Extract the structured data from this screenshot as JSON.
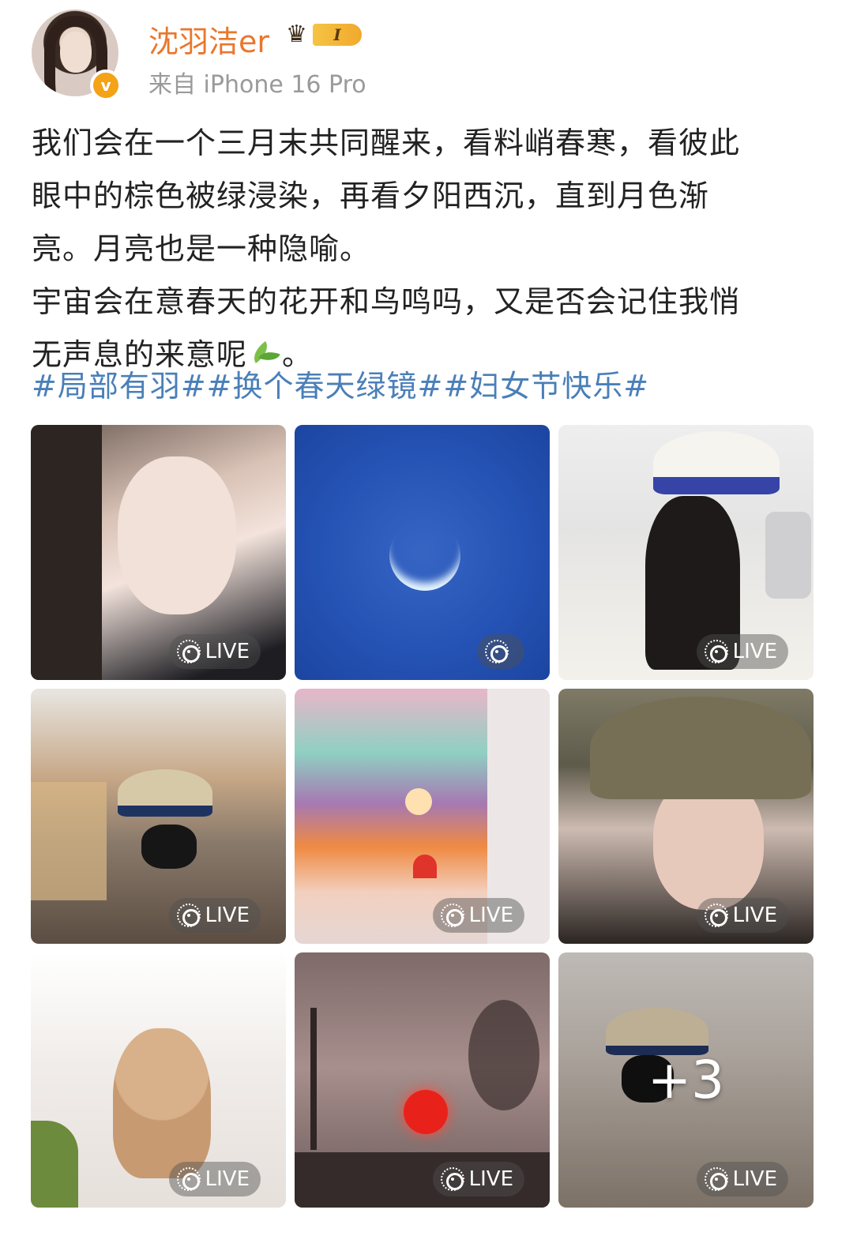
{
  "user": {
    "name": "沈羽洁er",
    "vip_level": "I",
    "source": "来自 iPhone 16 Pro"
  },
  "post": {
    "lines": [
      "我们会在一个三月末共同醒来，看料峭春寒，看彼此",
      "眼中的棕色被绿浸染，再看夕阳西沉，直到月色渐",
      "亮。月亮也是一种隐喻。",
      "宇宙会在意春天的花开和鸟鸣吗，又是否会记住我悄"
    ],
    "last_line": "无声息的来意呢",
    "last_line_end": "。",
    "hashtags": "#局部有羽##换个春天绿镜##妇女节快乐#"
  },
  "images": [
    {
      "live": "LIVE"
    },
    {
      "live": ""
    },
    {
      "live": "LIVE"
    },
    {
      "live": "LIVE"
    },
    {
      "live": "LIVE"
    },
    {
      "live": "LIVE"
    },
    {
      "live": "LIVE"
    },
    {
      "live": "LIVE"
    },
    {
      "live": "LIVE",
      "more": "+3"
    }
  ],
  "icons": {
    "verified": "verified-badge-icon",
    "crown": "crown-icon",
    "emoji": "leaf-emoji-icon",
    "live": "live-photo-icon"
  },
  "colors": {
    "username": "#e9772d",
    "hashtag": "#4a7fb8",
    "source": "#9a9a9a"
  }
}
